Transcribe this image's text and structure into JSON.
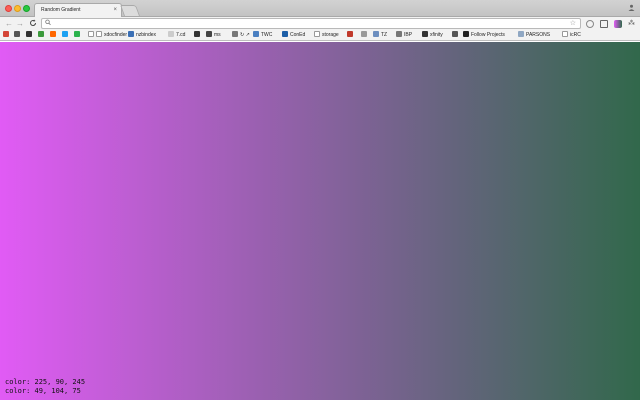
{
  "window": {
    "tab_title": "Random Gradient",
    "tab_close": "×",
    "profile_icon": "person-icon"
  },
  "toolbar": {
    "back": "←",
    "forward": "→",
    "reload": "C",
    "search_glyph": "⚲",
    "url": "",
    "star": "☆",
    "extension_icon": "⁂"
  },
  "bookmarks": [
    {
      "label": "",
      "icon": "gmail-icon",
      "color": "#d44638"
    },
    {
      "label": "",
      "icon": "grid-icon",
      "color": "#555555"
    },
    {
      "label": "",
      "icon": "github-icon",
      "color": "#333333"
    },
    {
      "label": "",
      "icon": "app-icon",
      "color": "#3c9a3c"
    },
    {
      "label": "",
      "icon": "y-icon",
      "color": "#ff6600"
    },
    {
      "label": "",
      "icon": "twitter-icon",
      "color": "#1da1f2"
    },
    {
      "label": "",
      "icon": "feedly-icon",
      "color": "#2bb24c"
    },
    {
      "label": "",
      "icon": "page-icon",
      "color": "#ffffff"
    },
    {
      "label": "xdocfinder",
      "icon": "page-icon",
      "color": "#ffffff"
    },
    {
      "label": "nzbindex",
      "icon": "nzb-icon",
      "color": "#3a6fb5"
    },
    {
      "label": "7.cd",
      "icon": "cloud-icon",
      "color": "#cccccc"
    },
    {
      "label": "",
      "icon": "x-icon",
      "color": "#333333"
    },
    {
      "label": "ms",
      "icon": "ms-icon",
      "color": "#444444"
    },
    {
      "label": "↻ ↗",
      "icon": "arrows-icon",
      "color": "#777777"
    },
    {
      "label": "TWC",
      "icon": "globe-icon",
      "color": "#4a7fc1"
    },
    {
      "label": "ConEd",
      "icon": "coned-icon",
      "color": "#1d5fa8"
    },
    {
      "label": "storage",
      "icon": "page-icon",
      "color": "#ffffff"
    },
    {
      "label": "",
      "icon": "bug-icon",
      "color": "#c0392b"
    },
    {
      "label": "",
      "icon": "box-icon",
      "color": "#999999"
    },
    {
      "label": "TZ",
      "icon": "calendar-icon",
      "color": "#6c8ebf"
    },
    {
      "label": "IBP",
      "icon": "chat-icon",
      "color": "#777777"
    },
    {
      "label": "xfinity",
      "icon": "play-icon",
      "color": "#333333"
    },
    {
      "label": "",
      "icon": "gear-icon",
      "color": "#555555"
    },
    {
      "label": "Follow Projects",
      "icon": "follow-icon",
      "color": "#222222"
    },
    {
      "label": "PARSONS",
      "icon": "folder-icon",
      "color": "#8fa7c3"
    },
    {
      "label": "icRC",
      "icon": "page-icon",
      "color": "#ffffff"
    }
  ],
  "gradient": {
    "start_color": "#e15bf5",
    "end_color": "#31684b",
    "direction": "to right"
  },
  "readout": {
    "line1": "color: 225, 90, 245",
    "line2": "color: 49, 104, 75"
  }
}
